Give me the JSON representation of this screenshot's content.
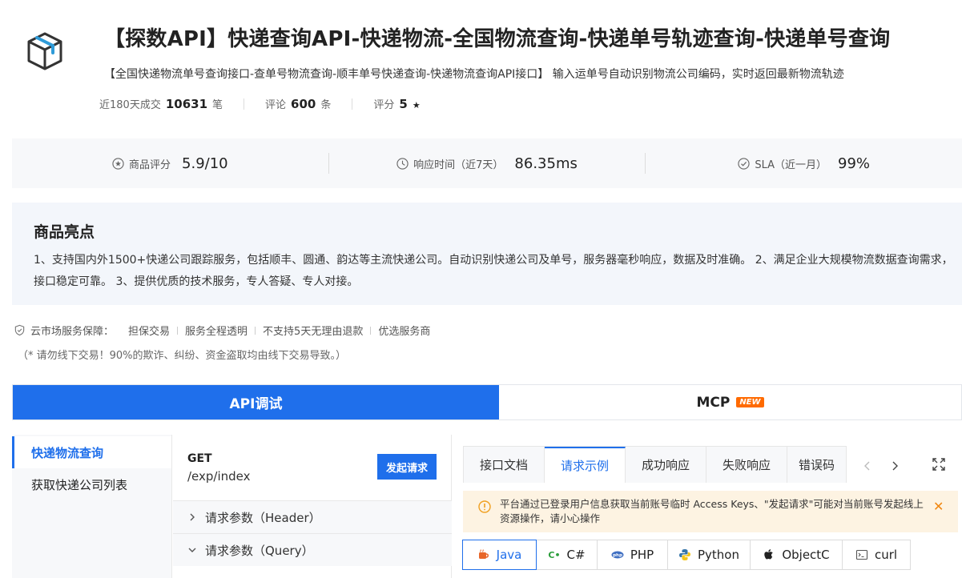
{
  "product": {
    "title": "【探数API】快递查询API-快递物流-全国物流查询-快递单号轨迹查询-快递单号查询",
    "subtitle": "【全国快递物流单号查询接口-查单号物流查询-顺丰单号快递查询-快递物流查询API接口】 输入运单号自动识别物流公司编码，实时返回最新物流轨迹",
    "stats": [
      {
        "label": "近180天成交",
        "value": "10631",
        "unit": "笔"
      },
      {
        "label": "评论",
        "value": "600",
        "unit": "条"
      },
      {
        "label": "评分",
        "value": "5",
        "unit": "★"
      }
    ]
  },
  "metrics": [
    {
      "icon": "star-circle-icon",
      "label": "商品评分",
      "value": "5.9/10"
    },
    {
      "icon": "clock-icon",
      "label": "响应时间（近7天）",
      "value": "86.35ms"
    },
    {
      "icon": "check-circle-icon",
      "label": "SLA（近一月）",
      "value": "99%"
    }
  ],
  "highlights": {
    "title": "商品亮点",
    "text": "1、支持国内外1500+快递公司跟踪服务，包括顺丰、圆通、韵达等主流快递公司。自动识别快递公司及单号，服务器毫秒响应，数据及时准确。 2、满足企业大规模物流数据查询需求，接口稳定可靠。 3、提供优质的技术服务，专人答疑、专人对接。"
  },
  "guarantee": {
    "title": "云市场服务保障：",
    "items": [
      "担保交易",
      "服务全程透明",
      "不支持5天无理由退款",
      "优选服务商"
    ],
    "notice": "（* 请勿线下交易！90%的欺诈、纠纷、资金盗取均由线下交易导致。）"
  },
  "main_tabs": {
    "active": "API调试",
    "other": "MCP",
    "badge": "NEW"
  },
  "api_list": [
    "快递物流查询",
    "获取快递公司列表"
  ],
  "endpoint": {
    "method": "GET",
    "path": "/exp/index",
    "send_label": "发起请求",
    "params": [
      "请求参数（Header）",
      "请求参数（Query）"
    ]
  },
  "doc_tabs": [
    "接口文档",
    "请求示例",
    "成功响应",
    "失败响应",
    "错误码"
  ],
  "warning": "平台通过已登录用户信息获取当前账号临时 Access Keys、\"发起请求\"可能对当前账号发起线上资源操作，请小心操作",
  "languages": [
    "Java",
    "C#",
    "PHP",
    "Python",
    "ObjectC",
    "curl"
  ],
  "colors": {
    "primary": "#1f6feb",
    "warning_bg": "#fdf3e2",
    "warning_accent": "#f0860f",
    "badge": "#ff6a00"
  }
}
